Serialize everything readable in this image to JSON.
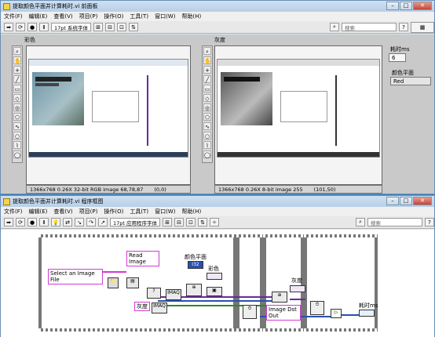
{
  "front_panel": {
    "title": "提取颜色平面并计算耗时.vi 前面板",
    "menu": [
      "文件(F)",
      "编辑(E)",
      "查看(V)",
      "项目(P)",
      "操作(O)",
      "工具(T)",
      "窗口(W)",
      "帮助(H)"
    ],
    "font_select": "17pt 系统字体",
    "search_placeholder": "搜索",
    "color_display": {
      "label": "彩色",
      "info": "1366x768 0.26X 32-bit RGB image 68,78,87",
      "coord": "(0,0)"
    },
    "gray_display": {
      "label": "灰度",
      "info": "1366x768 0.26X 8-bit image 255",
      "coord": "(101,50)"
    },
    "elapsed": {
      "label": "耗时ms",
      "value": "6"
    },
    "color_plane": {
      "label": "颜色平面",
      "value": "Red"
    }
  },
  "block_diagram": {
    "title": "提取颜色平面并计算耗时.vi 程序框图",
    "menu": [
      "文件(F)",
      "编辑(E)",
      "查看(V)",
      "项目(P)",
      "操作(O)",
      "工具(T)",
      "窗口(W)",
      "帮助(H)"
    ],
    "font_select": "17pt 应用程序字体",
    "search_placeholder": "搜索",
    "read_image_label": "Read\nImage",
    "select_image_file": "Select an Image File",
    "color_plane_label": "颜色平面",
    "color_plane_terminal": "I32",
    "color_label": "彩色",
    "gray_label": "灰度",
    "gray_label_out": "灰度",
    "image_dst_out": "Image Dst Out",
    "elapsed_label": "耗时ms",
    "imaq_label": "IMAQ"
  },
  "colors": {
    "titlebar": "#bcd2e9",
    "wire_pink": "#d23ad2",
    "wire_blue": "#2a4fb0",
    "wire_green": "#2a8a2a",
    "wire_purple": "#6a2a9a"
  }
}
